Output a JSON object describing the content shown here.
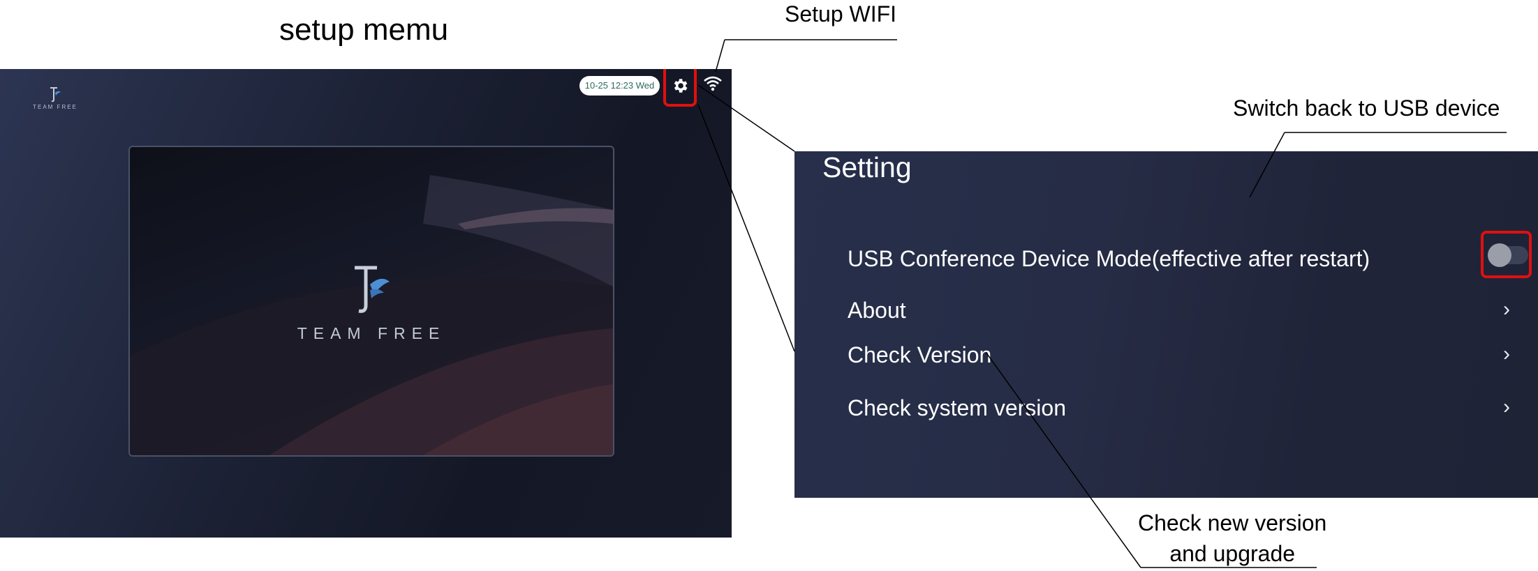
{
  "title": "setup memu",
  "callouts": {
    "wifi": "Setup WIFI",
    "usb_switch": "Switch back to USB device",
    "check_line1": "Check new version",
    "check_line2": "and upgrade"
  },
  "home_screen": {
    "logo_brand": "TEAM FREE",
    "datetime": "10-25 12:23 Wed",
    "icons": {
      "settings": "gear-icon",
      "wifi": "wifi-icon"
    },
    "center_brand": "TEAM FREE"
  },
  "settings": {
    "title": "Setting",
    "rows": [
      {
        "label": "USB Conference Device Mode(effective after restart)",
        "control": "toggle",
        "toggle_on": false
      },
      {
        "label": "About",
        "control": "chevron",
        "chevron": "›"
      },
      {
        "label": "Check Version",
        "control": "chevron",
        "chevron": "›"
      },
      {
        "label": "Check system version",
        "control": "chevron",
        "chevron": "›"
      }
    ]
  },
  "colors": {
    "highlight": "#e01010",
    "screen_bg": "#1f2336",
    "datetime_text": "#2d6b5e"
  }
}
